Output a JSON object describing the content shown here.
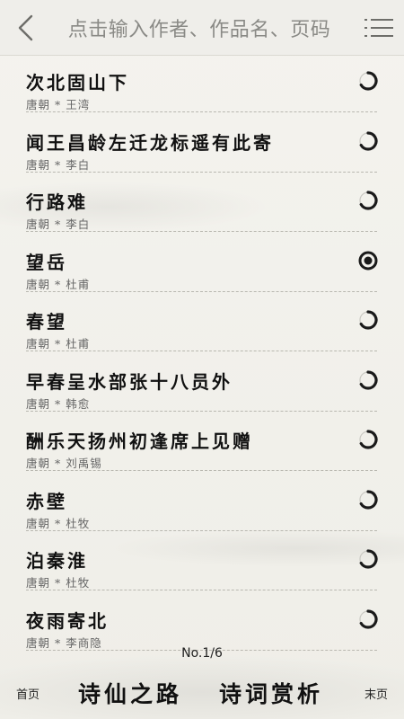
{
  "header": {
    "search_label": "点击输入作者、作品名、页码"
  },
  "poems": [
    {
      "title": "次北固山下",
      "meta": "唐朝 * 王湾",
      "status": "half"
    },
    {
      "title": "闻王昌龄左迁龙标遥有此寄",
      "meta": "唐朝 * 李白",
      "status": "half"
    },
    {
      "title": "行路难",
      "meta": "唐朝 * 李白",
      "status": "half"
    },
    {
      "title": "望岳",
      "meta": "唐朝 * 杜甫",
      "status": "full"
    },
    {
      "title": "春望",
      "meta": "唐朝 * 杜甫",
      "status": "half"
    },
    {
      "title": "早春呈水部张十八员外",
      "meta": "唐朝 * 韩愈",
      "status": "half"
    },
    {
      "title": "酬乐天扬州初逢席上见赠",
      "meta": "唐朝 * 刘禹锡",
      "status": "half"
    },
    {
      "title": "赤壁",
      "meta": "唐朝 * 杜牧",
      "status": "half"
    },
    {
      "title": "泊秦淮",
      "meta": "唐朝 * 杜牧",
      "status": "half"
    },
    {
      "title": "夜雨寄北",
      "meta": "唐朝 * 李商隐",
      "status": "half"
    }
  ],
  "pager": {
    "page_label": "No.1/6",
    "first_label": "首页",
    "last_label": "末页"
  },
  "footer": {
    "brand": "诗仙之路",
    "section": "诗词赏析"
  }
}
